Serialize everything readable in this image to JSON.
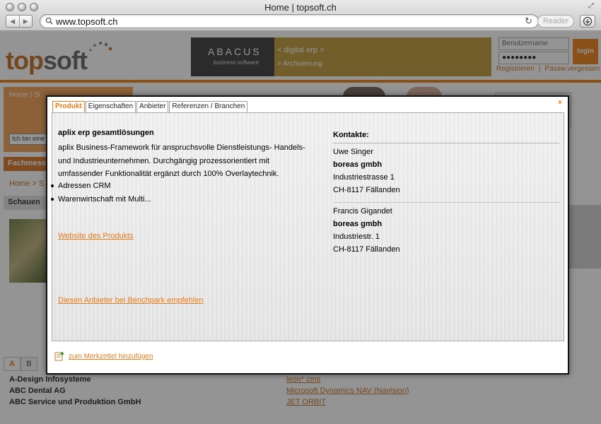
{
  "browser": {
    "title": "Home | topsoft.ch",
    "url": "www.topsoft.ch",
    "reader_label": "Reader"
  },
  "background": {
    "logo_top": "top",
    "logo_soft": "soft",
    "banner_brand": "ABACUS",
    "banner_brand_sub": "business software",
    "banner_line1": "< digital erp >",
    "banner_line2": "> Archivierung",
    "login_username_placeholder": "Benutzername",
    "login_password_value": "●●●●●●●●",
    "login_button": "login",
    "register_link": "Registrieren",
    "separator": "|",
    "forgot_link": "Passw.vergessen",
    "sidebar_crumb": "Home | Si",
    "search_value": "Ich bin eine",
    "fach_label": "Fachmess",
    "home_crumb": "Home > S",
    "schauen_label": "Schauen",
    "letters": [
      "A",
      "B"
    ],
    "list": [
      {
        "name": "A-Design Infosysteme",
        "product": "leon* cms"
      },
      {
        "name": "ABC Dental AG",
        "product": "Microsoft Dynamics NAV (Navision)"
      },
      {
        "name": "ABC Service und Produktion GmbH",
        "product": "JET ORBIT"
      }
    ]
  },
  "modal": {
    "tabs": [
      "Produkt",
      "Eigenschaften",
      "Anbieter",
      "Referenzen / Branchen"
    ],
    "close_glyph": "×",
    "product_title": "aplix erp gesamtlösungen",
    "description": "aplix Business-Framework für anspruchsvolle Dienstleistungs- Handels- und Industrieunternehmen. Durchgängig prozessorientiert mit umfassender Funktionalität ergänzt durch 100% Overlaytechnik.",
    "bullets": [
      "Adressen CRM",
      "Warenwirtschaft mit Multi..."
    ],
    "website_link": "Website des Produkts",
    "recommend_link": "Diesen Anbieter bei Benchpark empfehlen",
    "contacts_heading": "Kontakte:",
    "contacts": [
      {
        "person": "Uwe Singer",
        "company": "boreas gmbh",
        "street": "Industriestrasse 1",
        "city": "CH-8117 Fällanden"
      },
      {
        "person": "Francis Gigandet",
        "company": "boreas gmbh",
        "street": "Industriestr. 1",
        "city": "CH-8117 Fällanden"
      }
    ],
    "merkzettel_link": "zum Merkzettel hinzufügen"
  },
  "colors": {
    "accent": "#ec7b1a",
    "brand_orange": "#ec8a2a",
    "overlay": "rgba(0,0,0,0.42)"
  }
}
